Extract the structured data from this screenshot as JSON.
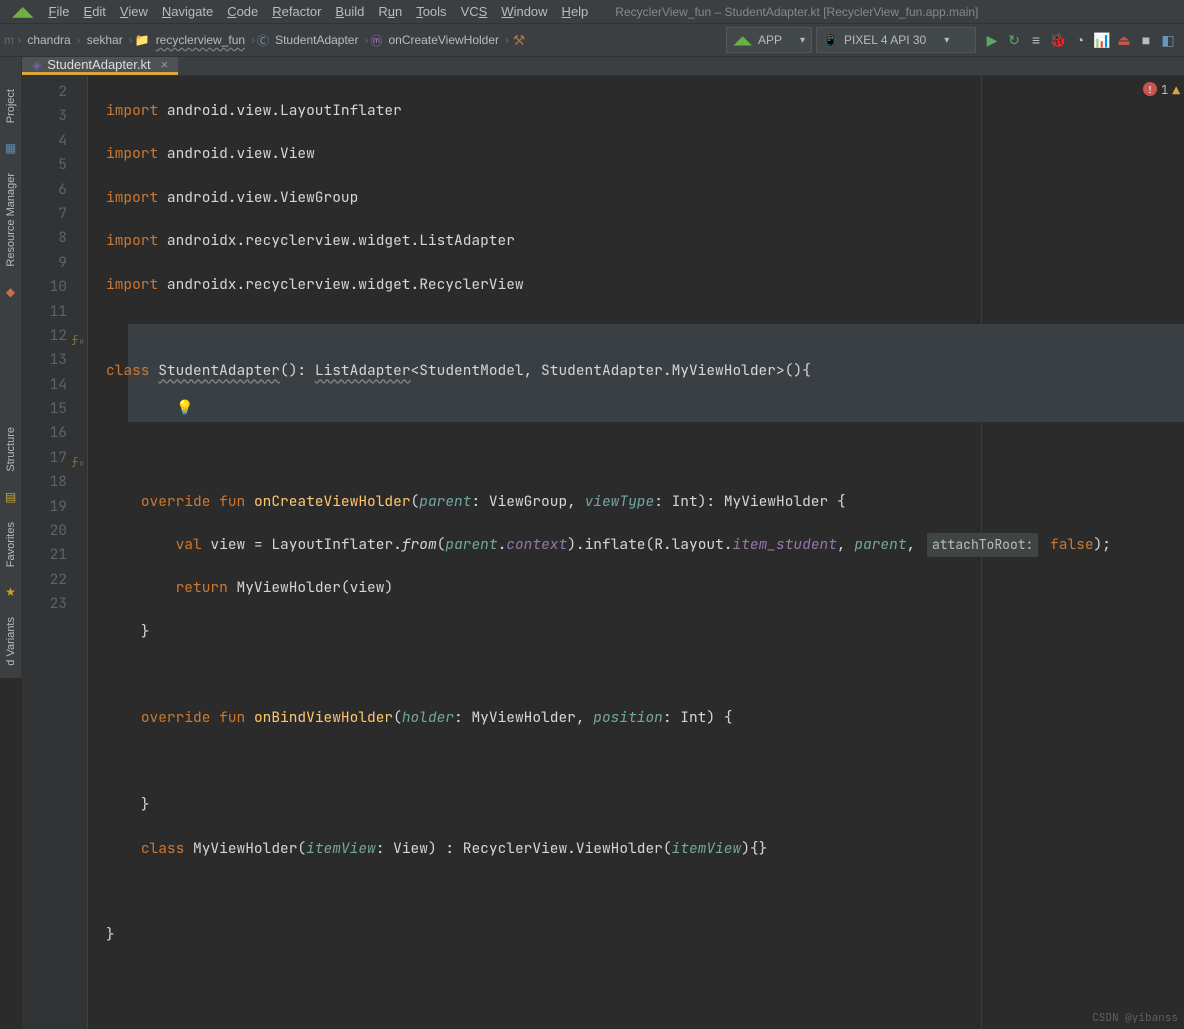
{
  "window_title": "RecyclerView_fun – StudentAdapter.kt [RecyclerView_fun.app.main]",
  "menu": {
    "file": "File",
    "edit": "Edit",
    "view": "View",
    "navigate": "Navigate",
    "code": "Code",
    "refactor": "Refactor",
    "build": "Build",
    "run": "Run",
    "tools": "Tools",
    "vcs": "VCS",
    "window": "Window",
    "help": "Help"
  },
  "breadcrumbs": {
    "b0": "chandra",
    "b1": "sekhar",
    "b2": "recyclerview_fun",
    "b3": "StudentAdapter",
    "b4": "onCreateViewHolder"
  },
  "configs": {
    "run_config": "APP",
    "device": "PIXEL 4 API 30"
  },
  "tab": {
    "name": "StudentAdapter.kt"
  },
  "sidebar": {
    "project": "Project",
    "resmgr": "Resource Manager",
    "structure": "Structure",
    "favorites": "Favorites",
    "variants": "d Variants"
  },
  "errors": {
    "count": "1"
  },
  "code": {
    "import_kw": "import",
    "l2": " android.view.LayoutInflater",
    "l3": " android.view.View",
    "l4": " android.view.ViewGroup",
    "l5": " androidx.recyclerview.widget.ListAdapter",
    "l6": " androidx.recyclerview.widget.RecyclerView",
    "class_kw": "class",
    "adapter_name": "StudentAdapter",
    "list_adapter": "ListAdapter",
    "student_model": "StudentModel",
    "student_adapter2": "StudentAdapter",
    "myvh": "MyViewHolder",
    "override_kw": "override",
    "fun_kw": "fun",
    "on_create": "onCreateViewHolder",
    "parent_p": "parent",
    "viewgroup_t": "ViewGroup",
    "viewtype_p": "viewType",
    "int_t": "Int",
    "val_kw": "val",
    "view_var": "view",
    "layout_infl": "LayoutInflater",
    "from_m": "from",
    "context_p": "context",
    "inflate_m": "inflate",
    "r_l": "R.layout.",
    "item_student": "item_student",
    "attach_hint": "attachToRoot:",
    "false_kw": "false",
    "return_kw": "return",
    "on_bind": "onBindViewHolder",
    "holder_p": "holder",
    "position_p": "position",
    "itemview_p": "itemView",
    "view_t": "View",
    "recycler_vh": "RecyclerView.ViewHolder"
  },
  "watermark": "CSDN @yibanss"
}
